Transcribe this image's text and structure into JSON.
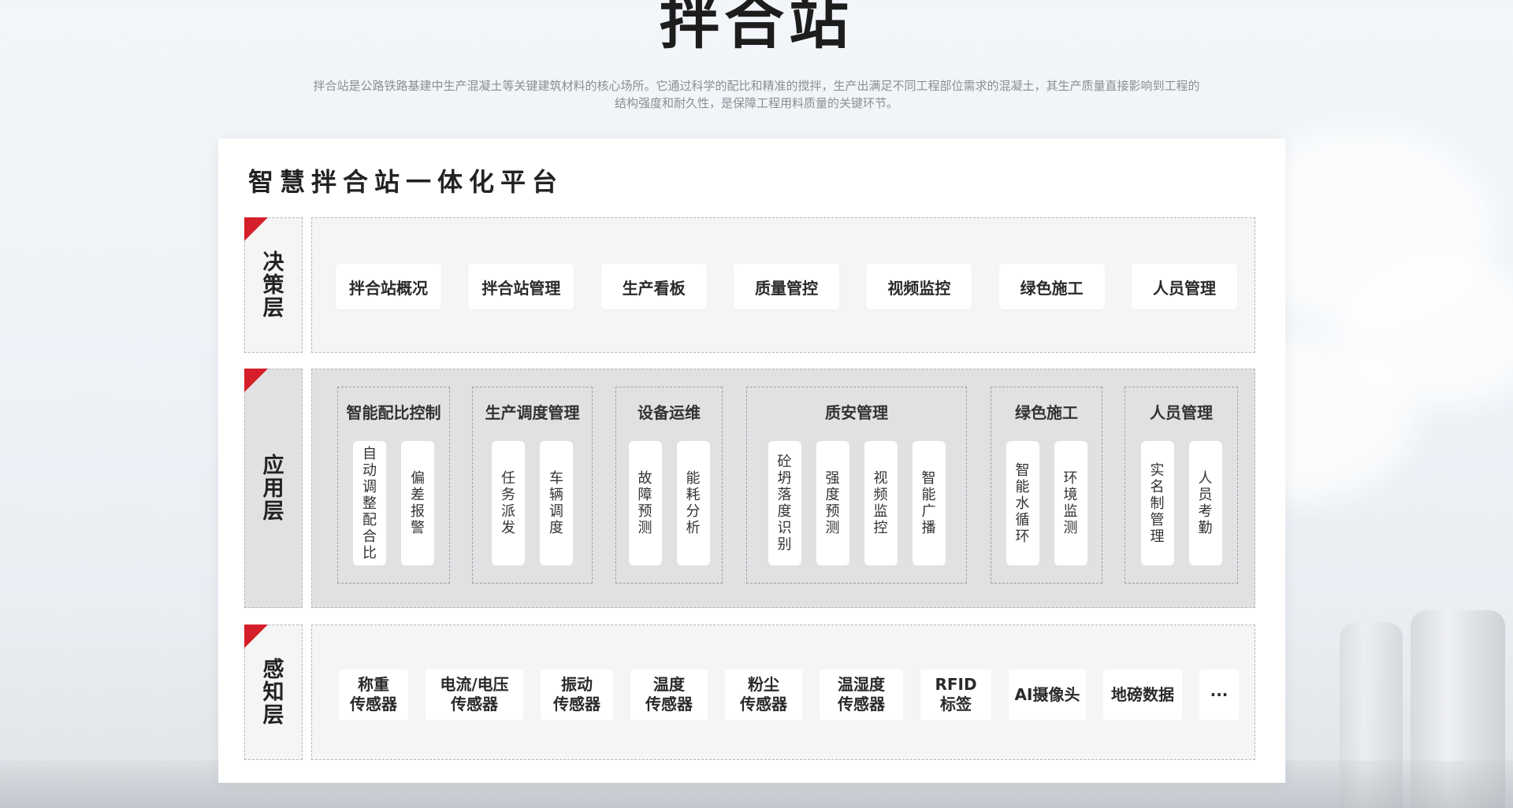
{
  "page": {
    "title": "拌合站",
    "description_line1": "拌合站是公路铁路基建中生产混凝土等关键建筑材料的核心场所。它通过科学的配比和精准的搅拌，生产出满足不同工程部位需求的混凝土，其生产质量直接影响到工程的",
    "description_line2": "结构强度和耐久性，是保障工程用料质量的关键环节。"
  },
  "platform": {
    "title": "智慧拌合站一体化平台",
    "accent_color": "#d51f2b",
    "layers": {
      "decision": {
        "label": "决策层",
        "items": [
          "拌合站概况",
          "拌合站管理",
          "生产看板",
          "质量管控",
          "视频监控",
          "绿色施工",
          "人员管理"
        ]
      },
      "application": {
        "label": "应用层",
        "groups": [
          {
            "title": "智能配比控制",
            "items": [
              "自动调整配合比",
              "偏差报警"
            ]
          },
          {
            "title": "生产调度管理",
            "items": [
              "任务派发",
              "车辆调度"
            ]
          },
          {
            "title": "设备运维",
            "items": [
              "故障预测",
              "能耗分析"
            ]
          },
          {
            "title": "质安管理",
            "items": [
              "砼坍落度识别",
              "强度预测",
              "视频监控",
              "智能广播"
            ]
          },
          {
            "title": "绿色施工",
            "items": [
              "智能水循环",
              "环境监测"
            ]
          },
          {
            "title": "人员管理",
            "items": [
              "实名制管理",
              "人员考勤"
            ]
          }
        ]
      },
      "perception": {
        "label": "感知层",
        "items": [
          {
            "line1": "称重",
            "line2": "传感器"
          },
          {
            "line1": "电流/电压",
            "line2": "传感器"
          },
          {
            "line1": "振动",
            "line2": "传感器"
          },
          {
            "line1": "温度",
            "line2": "传感器"
          },
          {
            "line1": "粉尘",
            "line2": "传感器"
          },
          {
            "line1": "温湿度",
            "line2": "传感器"
          },
          {
            "line1": "RFID",
            "line2": "标签"
          },
          {
            "line1": "AI摄像头",
            "line2": ""
          },
          {
            "line1": "地磅数据",
            "line2": ""
          },
          {
            "line1": "···",
            "line2": ""
          }
        ]
      }
    }
  }
}
